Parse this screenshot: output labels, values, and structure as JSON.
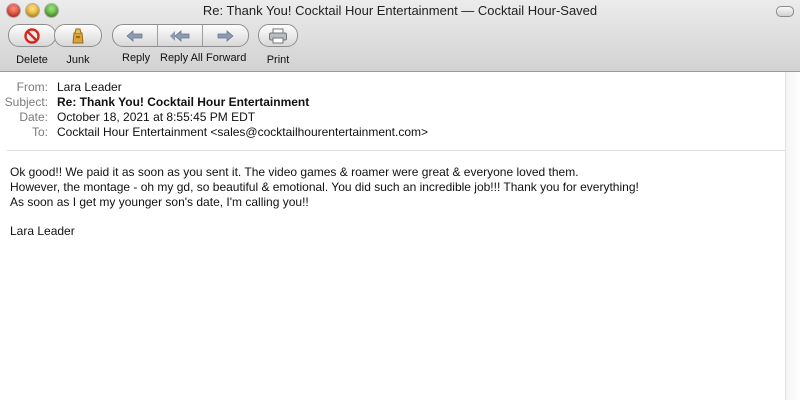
{
  "window": {
    "title": "Re: Thank You! Cocktail Hour Entertainment — Cocktail Hour-Saved"
  },
  "toolbar": {
    "delete_label": "Delete",
    "junk_label": "Junk",
    "reply_label": "Reply",
    "reply_all_label": "Reply All",
    "forward_label": "Forward",
    "print_label": "Print"
  },
  "headers": {
    "from_key": "From:",
    "from_value": "Lara Leader",
    "subject_key": "Subject:",
    "subject_value": "Re: Thank You! Cocktail Hour Entertainment",
    "date_key": "Date:",
    "date_value": "October 18, 2021 at 8:55:45 PM EDT",
    "to_key": "To:",
    "to_value": "Cocktail Hour Entertainment <sales@cocktailhourentertainment.com>"
  },
  "message": {
    "lines": [
      "Ok good!! We paid it as soon as you sent it. The video games & roamer were great & everyone loved them.",
      "However, the montage - oh my gd, so beautiful & emotional. You did such an incredible job!!! Thank you for everything!",
      "As soon as I get my younger son's date, I'm calling you!!"
    ],
    "signature": "Lara Leader"
  },
  "icons": {
    "delete": "no-entry-icon",
    "junk": "junk-bag-icon",
    "reply": "reply-arrow-icon",
    "reply_all": "reply-all-arrow-icon",
    "forward": "forward-arrow-icon",
    "print": "printer-icon"
  },
  "colors": {
    "delete_red": "#d8261c",
    "junk_gold": "#c98b1e",
    "header_key_gray": "#7a7a7a"
  }
}
